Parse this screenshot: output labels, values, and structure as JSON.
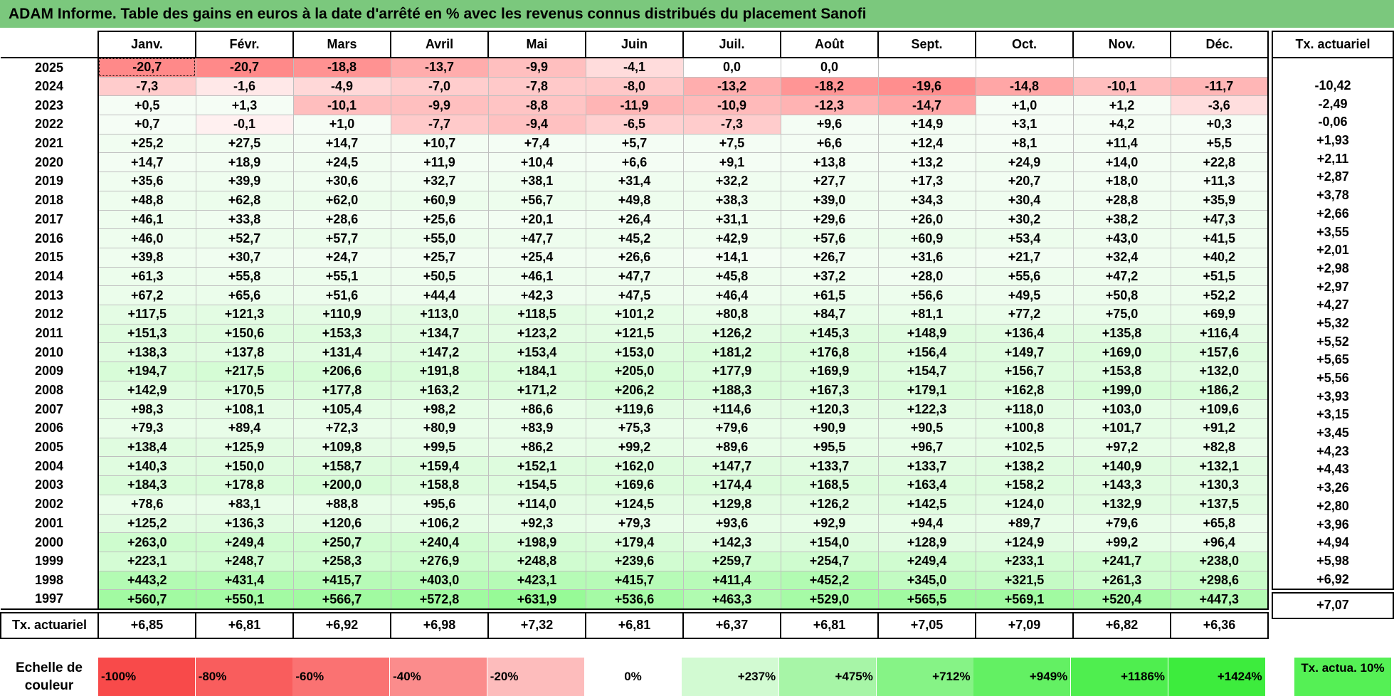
{
  "title": "ADAM Informe. Table des gains en euros à la date d'arrêté en % avec les revenus connus distribués du placement Sanofi",
  "months": [
    "Janv.",
    "Févr.",
    "Mars",
    "Avril",
    "Mai",
    "Juin",
    "Juil.",
    "Août",
    "Sept.",
    "Oct.",
    "Nov.",
    "Déc."
  ],
  "side_header": "Tx. actuariel",
  "rows": [
    {
      "year": "2025",
      "values": [
        "-20,7",
        "-20,7",
        "-18,8",
        "-13,7",
        "-9,9",
        "-4,1",
        "0,0",
        "0,0",
        "",
        "",
        "",
        ""
      ],
      "tx": ""
    },
    {
      "year": "2024",
      "values": [
        "-7,3",
        "-1,6",
        "-4,9",
        "-7,0",
        "-7,8",
        "-8,0",
        "-13,2",
        "-18,2",
        "-19,6",
        "-14,8",
        "-10,1",
        "-11,7"
      ],
      "tx": "-10,42"
    },
    {
      "year": "2023",
      "values": [
        "+0,5",
        "+1,3",
        "-10,1",
        "-9,9",
        "-8,8",
        "-11,9",
        "-10,9",
        "-12,3",
        "-14,7",
        "+1,0",
        "+1,2",
        "-3,6"
      ],
      "tx": "-2,49"
    },
    {
      "year": "2022",
      "values": [
        "+0,7",
        "-0,1",
        "+1,0",
        "-7,7",
        "-9,4",
        "-6,5",
        "-7,3",
        "+9,6",
        "+14,9",
        "+3,1",
        "+4,2",
        "+0,3"
      ],
      "tx": "-0,06"
    },
    {
      "year": "2021",
      "values": [
        "+25,2",
        "+27,5",
        "+14,7",
        "+10,7",
        "+7,4",
        "+5,7",
        "+7,5",
        "+6,6",
        "+12,4",
        "+8,1",
        "+11,4",
        "+5,5"
      ],
      "tx": "+1,93"
    },
    {
      "year": "2020",
      "values": [
        "+14,7",
        "+18,9",
        "+24,5",
        "+11,9",
        "+10,4",
        "+6,6",
        "+9,1",
        "+13,8",
        "+13,2",
        "+24,9",
        "+14,0",
        "+22,8"
      ],
      "tx": "+2,11"
    },
    {
      "year": "2019",
      "values": [
        "+35,6",
        "+39,9",
        "+30,6",
        "+32,7",
        "+38,1",
        "+31,4",
        "+32,2",
        "+27,7",
        "+17,3",
        "+20,7",
        "+18,0",
        "+11,3"
      ],
      "tx": "+2,87"
    },
    {
      "year": "2018",
      "values": [
        "+48,8",
        "+62,8",
        "+62,0",
        "+60,9",
        "+56,7",
        "+49,8",
        "+38,3",
        "+39,0",
        "+34,3",
        "+30,4",
        "+28,8",
        "+35,9"
      ],
      "tx": "+3,78"
    },
    {
      "year": "2017",
      "values": [
        "+46,1",
        "+33,8",
        "+28,6",
        "+25,6",
        "+20,1",
        "+26,4",
        "+31,1",
        "+29,6",
        "+26,0",
        "+30,2",
        "+38,2",
        "+47,3"
      ],
      "tx": "+2,66"
    },
    {
      "year": "2016",
      "values": [
        "+46,0",
        "+52,7",
        "+57,7",
        "+55,0",
        "+47,7",
        "+45,2",
        "+42,9",
        "+57,6",
        "+60,9",
        "+53,4",
        "+43,0",
        "+41,5"
      ],
      "tx": "+3,55"
    },
    {
      "year": "2015",
      "values": [
        "+39,8",
        "+30,7",
        "+24,7",
        "+25,7",
        "+25,4",
        "+26,6",
        "+14,1",
        "+26,7",
        "+31,6",
        "+21,7",
        "+32,4",
        "+40,2"
      ],
      "tx": "+2,01"
    },
    {
      "year": "2014",
      "values": [
        "+61,3",
        "+55,8",
        "+55,1",
        "+50,5",
        "+46,1",
        "+47,7",
        "+45,8",
        "+37,2",
        "+28,0",
        "+55,6",
        "+47,2",
        "+51,5"
      ],
      "tx": "+2,98"
    },
    {
      "year": "2013",
      "values": [
        "+67,2",
        "+65,6",
        "+51,6",
        "+44,4",
        "+42,3",
        "+47,5",
        "+46,4",
        "+61,5",
        "+56,6",
        "+49,5",
        "+50,8",
        "+52,2"
      ],
      "tx": "+2,97"
    },
    {
      "year": "2012",
      "values": [
        "+117,5",
        "+121,3",
        "+110,9",
        "+113,0",
        "+118,5",
        "+101,2",
        "+80,8",
        "+84,7",
        "+81,1",
        "+77,2",
        "+75,0",
        "+69,9"
      ],
      "tx": "+4,27"
    },
    {
      "year": "2011",
      "values": [
        "+151,3",
        "+150,6",
        "+153,3",
        "+134,7",
        "+123,2",
        "+121,5",
        "+126,2",
        "+145,3",
        "+148,9",
        "+136,4",
        "+135,8",
        "+116,4"
      ],
      "tx": "+5,32"
    },
    {
      "year": "2010",
      "values": [
        "+138,3",
        "+137,8",
        "+131,4",
        "+147,2",
        "+153,4",
        "+153,0",
        "+181,2",
        "+176,8",
        "+156,4",
        "+149,7",
        "+169,0",
        "+157,6"
      ],
      "tx": "+5,52"
    },
    {
      "year": "2009",
      "values": [
        "+194,7",
        "+217,5",
        "+206,6",
        "+191,8",
        "+184,1",
        "+205,0",
        "+177,9",
        "+169,9",
        "+154,7",
        "+156,7",
        "+153,8",
        "+132,0"
      ],
      "tx": "+5,65"
    },
    {
      "year": "2008",
      "values": [
        "+142,9",
        "+170,5",
        "+177,8",
        "+163,2",
        "+171,2",
        "+206,2",
        "+188,3",
        "+167,3",
        "+179,1",
        "+162,8",
        "+199,0",
        "+186,2"
      ],
      "tx": "+5,56"
    },
    {
      "year": "2007",
      "values": [
        "+98,3",
        "+108,1",
        "+105,4",
        "+98,2",
        "+86,6",
        "+119,6",
        "+114,6",
        "+120,3",
        "+122,3",
        "+118,0",
        "+103,0",
        "+109,6"
      ],
      "tx": "+3,93"
    },
    {
      "year": "2006",
      "values": [
        "+79,3",
        "+89,4",
        "+72,3",
        "+80,9",
        "+83,9",
        "+75,3",
        "+79,6",
        "+90,9",
        "+90,5",
        "+100,8",
        "+101,7",
        "+91,2"
      ],
      "tx": "+3,15"
    },
    {
      "year": "2005",
      "values": [
        "+138,4",
        "+125,9",
        "+109,8",
        "+99,5",
        "+86,2",
        "+99,2",
        "+89,6",
        "+95,5",
        "+96,7",
        "+102,5",
        "+97,2",
        "+82,8"
      ],
      "tx": "+3,45"
    },
    {
      "year": "2004",
      "values": [
        "+140,3",
        "+150,0",
        "+158,7",
        "+159,4",
        "+152,1",
        "+162,0",
        "+147,7",
        "+133,7",
        "+133,7",
        "+138,2",
        "+140,9",
        "+132,1"
      ],
      "tx": "+4,23"
    },
    {
      "year": "2003",
      "values": [
        "+184,3",
        "+178,8",
        "+200,0",
        "+158,8",
        "+154,5",
        "+169,6",
        "+174,4",
        "+168,5",
        "+163,4",
        "+158,2",
        "+143,3",
        "+130,3"
      ],
      "tx": "+4,43"
    },
    {
      "year": "2002",
      "values": [
        "+78,6",
        "+83,1",
        "+88,8",
        "+95,6",
        "+114,0",
        "+124,5",
        "+129,8",
        "+126,2",
        "+142,5",
        "+124,0",
        "+132,9",
        "+137,5"
      ],
      "tx": "+3,26"
    },
    {
      "year": "2001",
      "values": [
        "+125,2",
        "+136,3",
        "+120,6",
        "+106,2",
        "+92,3",
        "+79,3",
        "+93,6",
        "+92,9",
        "+94,4",
        "+89,7",
        "+79,6",
        "+65,8"
      ],
      "tx": "+2,80"
    },
    {
      "year": "2000",
      "values": [
        "+263,0",
        "+249,4",
        "+250,7",
        "+240,4",
        "+198,9",
        "+179,4",
        "+142,3",
        "+154,0",
        "+128,9",
        "+124,9",
        "+99,2",
        "+96,4"
      ],
      "tx": "+3,96"
    },
    {
      "year": "1999",
      "values": [
        "+223,1",
        "+248,7",
        "+258,3",
        "+276,9",
        "+248,8",
        "+239,6",
        "+259,7",
        "+254,7",
        "+249,4",
        "+233,1",
        "+241,7",
        "+238,0"
      ],
      "tx": "+4,94"
    },
    {
      "year": "1998",
      "values": [
        "+443,2",
        "+431,4",
        "+415,7",
        "+403,0",
        "+423,1",
        "+415,7",
        "+411,4",
        "+452,2",
        "+345,0",
        "+321,5",
        "+261,3",
        "+298,6"
      ],
      "tx": "+5,98"
    },
    {
      "year": "1997",
      "values": [
        "+560,7",
        "+550,1",
        "+566,7",
        "+572,8",
        "+631,9",
        "+536,6",
        "+463,3",
        "+529,0",
        "+565,5",
        "+569,1",
        "+520,4",
        "+447,3"
      ],
      "tx": "+6,92"
    }
  ],
  "footer": {
    "label": "Tx. actuariel",
    "values": [
      "+6,85",
      "+6,81",
      "+6,92",
      "+6,98",
      "+7,32",
      "+6,81",
      "+6,37",
      "+6,81",
      "+7,05",
      "+7,09",
      "+6,82",
      "+6,36"
    ],
    "tx": "+7,07"
  },
  "scale": {
    "label": "Echelle de couleur",
    "steps": [
      {
        "label": "-100%",
        "color": "#f84a4a"
      },
      {
        "label": "-80%",
        "color": "#f95d5d"
      },
      {
        "label": "-60%",
        "color": "#fa7272"
      },
      {
        "label": "-40%",
        "color": "#fb8c8c"
      },
      {
        "label": "-20%",
        "color": "#fdbcbc"
      },
      {
        "label": "0%",
        "color": "#ffffff"
      },
      {
        "label": "+237%",
        "color": "#d2fad2"
      },
      {
        "label": "+475%",
        "color": "#a7f5a7"
      },
      {
        "label": "+712%",
        "color": "#86f386"
      },
      {
        "label": "+949%",
        "color": "#63f063"
      },
      {
        "label": "+1186%",
        "color": "#4fee4f"
      },
      {
        "label": "+1424%",
        "color": "#3dec3d"
      }
    ],
    "actua_label": "Tx. actua. 10%"
  }
}
